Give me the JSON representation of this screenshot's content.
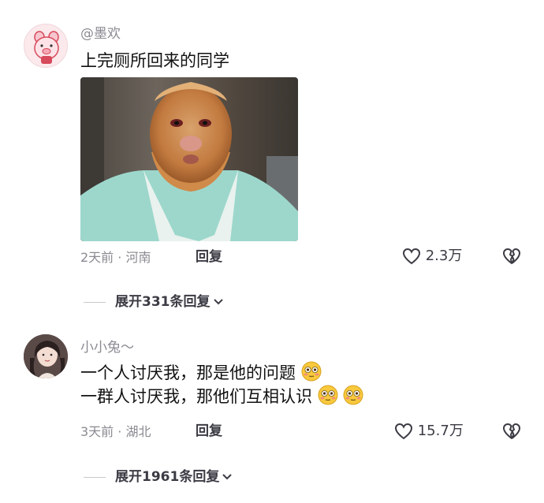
{
  "comments": [
    {
      "username": "@墨欢",
      "text_lines": [
        "上完厕所回来的同学"
      ],
      "time": "2天前",
      "location": "河南",
      "reply_label": "回复",
      "likes": "2.3万",
      "expand_label": "展开331条回复"
    },
    {
      "username": "小小兔～",
      "text_lines": [
        "一个人讨厌我，那是他的问题",
        "一群人讨厌我，那他们互相认识"
      ],
      "time": "3天前",
      "location": "湖北",
      "reply_label": "回复",
      "likes": "15.7万",
      "expand_label": "展开1961条回复"
    }
  ],
  "separator": "·",
  "colors": {
    "meta_gray": "#8a8a92",
    "text_dark": "#111111",
    "emoji_yellow": "#f8c93c"
  }
}
